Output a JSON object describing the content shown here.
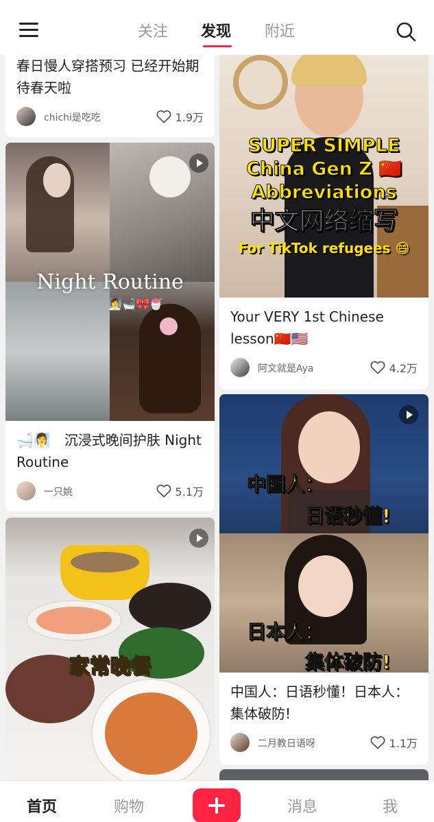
{
  "topbar": {
    "tabs": [
      "关注",
      "发现",
      "附近"
    ],
    "active_tab": "发现",
    "icons": [
      "menu-icon",
      "search-icon"
    ]
  },
  "feed": {
    "left": [
      {
        "title": "春日慢人穿搭预习 已经开始期待春天啦",
        "author": "chichi是吃吃",
        "likes": "1.9万"
      },
      {
        "overlay": "Night Routine",
        "overlay_emoji": "🧖‍♀️🛁🎀🍧",
        "title": "🛁🧖‍♀️　沉浸式晚间护肤 Night Routine",
        "author": "一只姚",
        "likes": "5.1万"
      },
      {
        "overlay": "家常晚餐"
      }
    ],
    "right": [
      {
        "overlay_lines": [
          "SUPER SIMPLE",
          "China Gen Z 🇨🇳",
          "Abbreviations",
          "中文网络缩写",
          "For TikTok refugees 😄"
        ],
        "title": "Your VERY 1st Chinese lesson🇨🇳🇺🇸",
        "author": "阿文就是Aya",
        "likes": "4.2万"
      },
      {
        "overlay_top": [
          "中国人：",
          "日语秒懂!"
        ],
        "overlay_bottom": [
          "日本人：",
          "集体破防!"
        ],
        "title": "中国人：日语秒懂！日本人：集体破防!",
        "author": "二月教日语呀",
        "likes": "1.1万"
      }
    ]
  },
  "bottombar": {
    "items": [
      "首页",
      "购物",
      "消息",
      "我"
    ],
    "active": "首页"
  },
  "colors": {
    "accent": "#ff2442"
  }
}
